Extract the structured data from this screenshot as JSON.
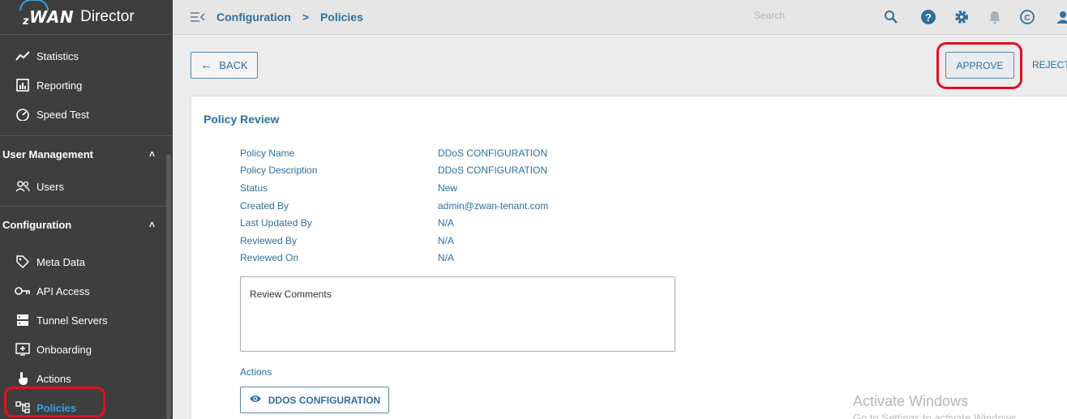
{
  "brand": {
    "logo_text": "WAN",
    "logo_prefix": "z",
    "title": "Director",
    "accent": "#3aa0e0"
  },
  "sidebar": {
    "top_items": [
      {
        "label": "Statistics",
        "icon": "chart-line-icon"
      },
      {
        "label": "Reporting",
        "icon": "bar-chart-icon"
      },
      {
        "label": "Speed Test",
        "icon": "speedometer-icon"
      }
    ],
    "user_management": {
      "label": "User Management",
      "items": [
        {
          "label": "Users",
          "icon": "users-icon"
        }
      ]
    },
    "configuration": {
      "label": "Configuration",
      "items": [
        {
          "label": "Meta Data",
          "icon": "tag-icon"
        },
        {
          "label": "API Access",
          "icon": "key-icon"
        },
        {
          "label": "Tunnel Servers",
          "icon": "server-icon"
        },
        {
          "label": "Onboarding",
          "icon": "add-box-icon"
        },
        {
          "label": "Actions",
          "icon": "touch-icon"
        },
        {
          "label": "Policies",
          "icon": "hierarchy-icon"
        }
      ]
    }
  },
  "header": {
    "breadcrumb": [
      "Configuration",
      "Policies"
    ],
    "search_placeholder": "Search"
  },
  "toolbar": {
    "back": "BACK",
    "approve": "APPROVE",
    "reject": "REJECT"
  },
  "review": {
    "title": "Policy Review",
    "fields": [
      {
        "key": "Policy Name",
        "value": "DDoS CONFIGURATION"
      },
      {
        "key": "Policy Description",
        "value": "DDoS CONFIGURATION"
      },
      {
        "key": "Status",
        "value": "New"
      },
      {
        "key": "Created By",
        "value": "admin@zwan-tenant.com"
      },
      {
        "key": "Last Updated By",
        "value": "N/A"
      },
      {
        "key": "Reviewed By",
        "value": "N/A"
      },
      {
        "key": "Reviewed On",
        "value": "N/A"
      }
    ],
    "comments_label": "Review Comments",
    "actions_label": "Actions",
    "action_button": "DDOS CONFIGURATION"
  },
  "watermark": {
    "line1": "Activate Windows",
    "line2": "Go to Settings to activate Windows."
  }
}
